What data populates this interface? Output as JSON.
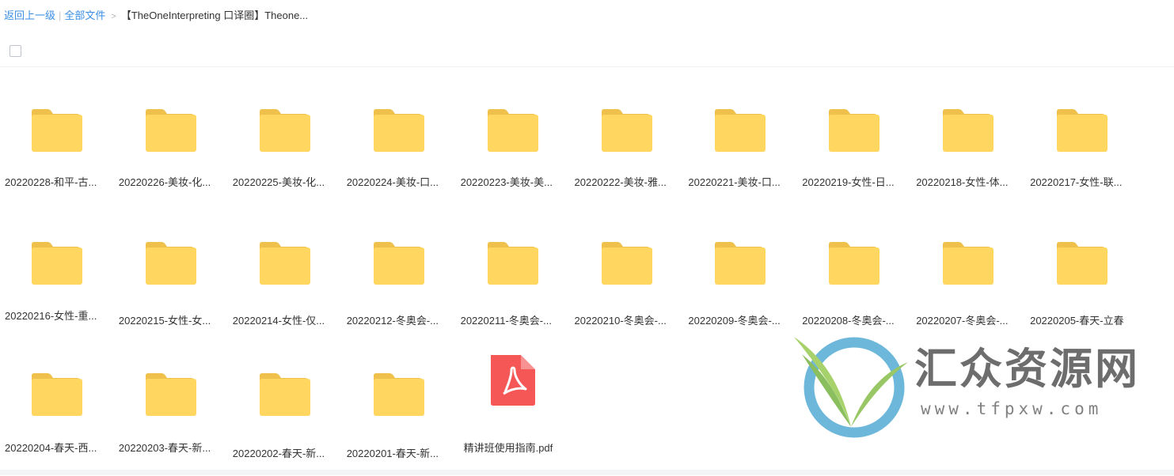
{
  "breadcrumb": {
    "back": "返回上一级",
    "separator": "|",
    "all_files": "全部文件",
    "arrow": ">",
    "current": "【TheOneInterpreting 口译圈】Theone..."
  },
  "colors": {
    "link": "#3a8ee6",
    "folder_back": "#f0c04c",
    "folder_front": "#ffd660",
    "pdf": "#f55656"
  },
  "files": [
    {
      "name": "20220228-和平-古...",
      "icon": "folder-icon"
    },
    {
      "name": "20220226-美妆-化...",
      "icon": "folder-icon"
    },
    {
      "name": "20220225-美妆-化...",
      "icon": "folder-icon"
    },
    {
      "name": "20220224-美妆-口...",
      "icon": "folder-icon"
    },
    {
      "name": "20220223-美妆-美...",
      "icon": "folder-icon"
    },
    {
      "name": "20220222-美妆-雅...",
      "icon": "folder-icon"
    },
    {
      "name": "20220221-美妆-口...",
      "icon": "folder-icon"
    },
    {
      "name": "20220219-女性-日...",
      "icon": "folder-icon"
    },
    {
      "name": "20220218-女性-体...",
      "icon": "folder-icon"
    },
    {
      "name": "20220217-女性-联...",
      "icon": "folder-icon"
    },
    {
      "name": "20220216-女性-重...",
      "icon": "folder-icon"
    },
    {
      "name": "20220215-女性-女...",
      "icon": "folder-icon"
    },
    {
      "name": "20220214-女性-仅...",
      "icon": "folder-icon"
    },
    {
      "name": "20220212-冬奥会-...",
      "icon": "folder-icon"
    },
    {
      "name": "20220211-冬奥会-...",
      "icon": "folder-icon"
    },
    {
      "name": "20220210-冬奥会-...",
      "icon": "folder-icon"
    },
    {
      "name": "20220209-冬奥会-...",
      "icon": "folder-icon"
    },
    {
      "name": "20220208-冬奥会-...",
      "icon": "folder-icon"
    },
    {
      "name": "20220207-冬奥会-...",
      "icon": "folder-icon"
    },
    {
      "name": "20220205-春天-立春",
      "icon": "folder-icon"
    },
    {
      "name": "20220204-春天-西...",
      "icon": "folder-icon"
    },
    {
      "name": "20220203-春天-新...",
      "icon": "folder-icon"
    },
    {
      "name": "20220202-春天-新...",
      "icon": "folder-icon"
    },
    {
      "name": "20220201-春天-新...",
      "icon": "folder-icon"
    },
    {
      "name": "精讲班使用指南.pdf",
      "icon": "pdf-file-icon"
    }
  ],
  "watermark": {
    "brand": "汇众资源网",
    "url": "www.tfpxw.com"
  }
}
